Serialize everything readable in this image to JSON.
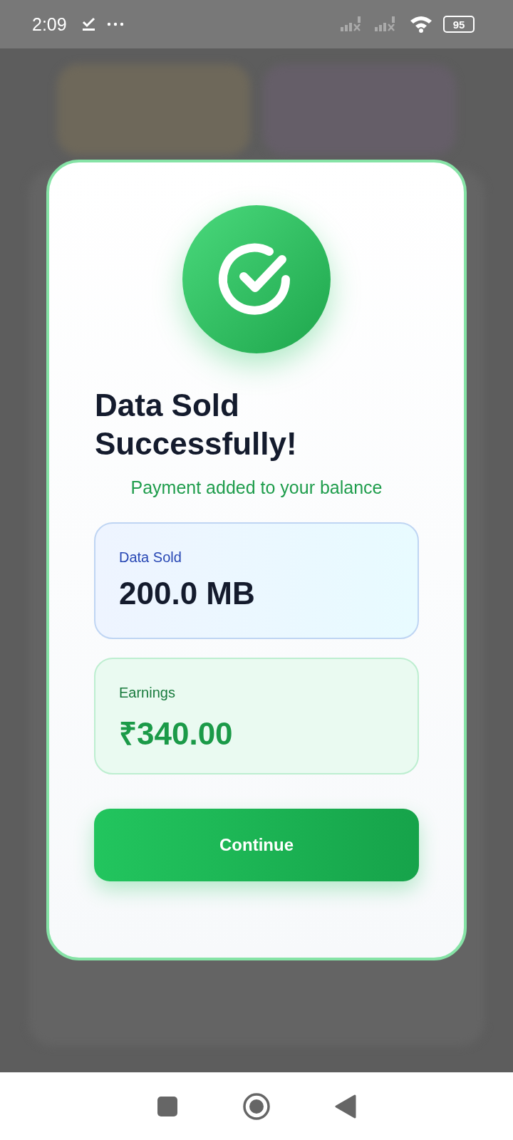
{
  "status_bar": {
    "time": "2:09",
    "battery": "95"
  },
  "dialog": {
    "title": "Data Sold Successfully!",
    "subtitle": "Payment added to your balance",
    "stats": [
      {
        "kind": "data",
        "label": "Data Sold",
        "value": "200.0 MB"
      },
      {
        "kind": "earnings",
        "label": "Earnings",
        "value": "₹340.00"
      }
    ],
    "button": "Continue"
  }
}
